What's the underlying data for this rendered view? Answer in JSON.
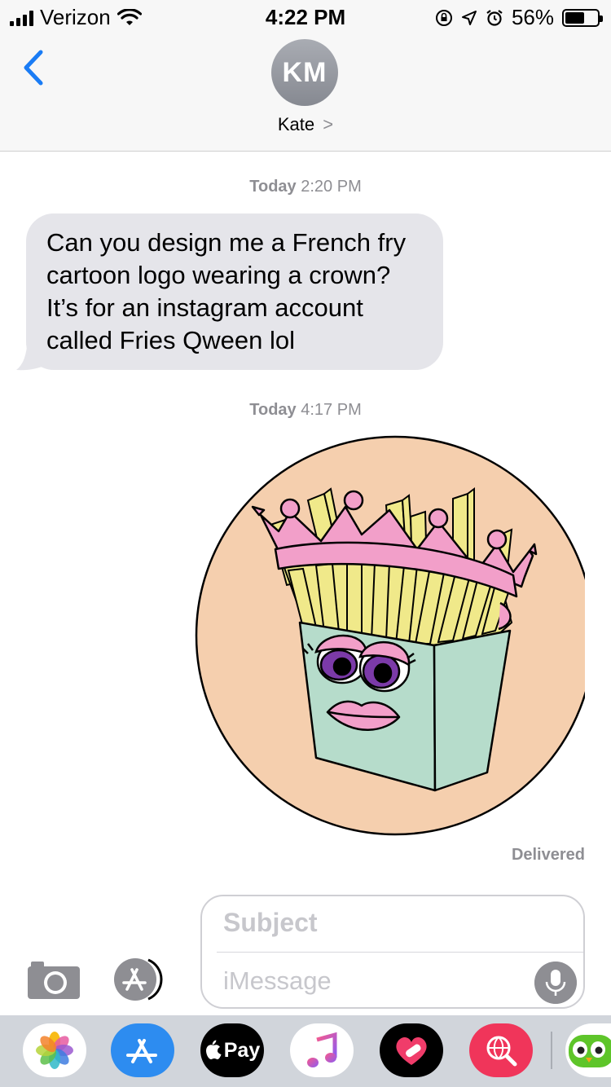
{
  "status_bar": {
    "carrier": "Verizon",
    "time": "4:22 PM",
    "battery_percent": "56%",
    "battery_level": 0.56,
    "icons": [
      "signal-icon",
      "wifi-icon",
      "rotation-lock-icon",
      "location-icon",
      "alarm-icon",
      "battery-icon"
    ]
  },
  "header": {
    "avatar_initials": "KM",
    "contact_name": "Kate",
    "contact_chevron": ">"
  },
  "conversation": {
    "timestamp_1": {
      "day": "Today",
      "time": "2:20 PM"
    },
    "message_1": "Can you design me a French fry cartoon logo wearing a crown? It’s for an instagram account called Fries Qween lol",
    "timestamp_2": {
      "day": "Today",
      "time": "4:17 PM"
    },
    "image_description_icon": "fries-queen-logo-image",
    "status": "Delivered"
  },
  "compose": {
    "subject_placeholder": "Subject",
    "message_placeholder": "iMessage"
  },
  "app_drawer": {
    "apps": [
      "photos-app-icon",
      "app-store-icon",
      "apple-pay-icon",
      "music-app-icon",
      "heart-stickers-icon",
      "web-search-icon",
      "duolingo-icon"
    ],
    "apple_pay_label": "Pay"
  },
  "colors": {
    "ios_blue": "#1a7cf5",
    "bubble_gray": "#e5e5ea",
    "secondary_text": "#8e8e93",
    "logo_background": "#f5cfae",
    "fries_yellow": "#f0e98a",
    "crown_pink": "#f29fc9",
    "box_mint": "#b6dccb"
  }
}
